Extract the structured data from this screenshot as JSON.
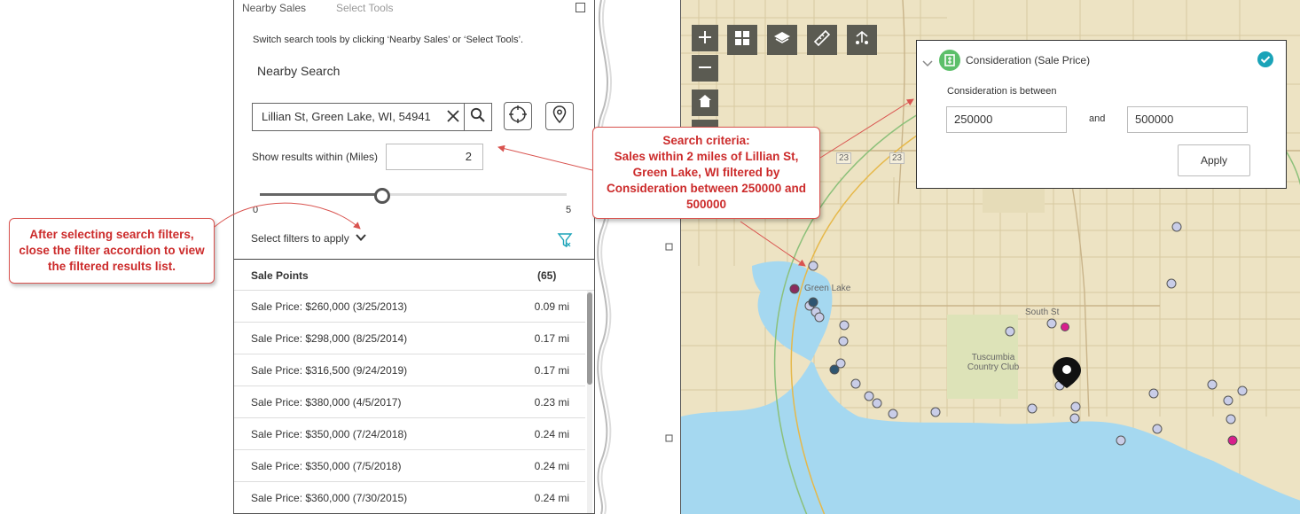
{
  "panel": {
    "tabs": [
      "Nearby Sales",
      "Select Tools"
    ],
    "instruction": "Switch search tools by clicking ‘Nearby Sales’ or ‘Select Tools’.",
    "section_title": "Nearby Search",
    "search_value": "Lillian St, Green Lake, WI, 54941",
    "distance_label": "Show results within (Miles)",
    "distance_value": "2",
    "slider": {
      "min": "0",
      "max": "5",
      "value_fraction": 0.4
    },
    "filters_label": "Select filters to apply",
    "results_title": "Sale Points",
    "results_count": "(65)",
    "results": [
      {
        "price": "Sale Price: $260,000 (3/25/2013)",
        "dist": "0.09 mi"
      },
      {
        "price": "Sale Price: $298,000 (8/25/2014)",
        "dist": "0.17 mi"
      },
      {
        "price": "Sale Price: $316,500 (9/24/2019)",
        "dist": "0.17 mi"
      },
      {
        "price": "Sale Price: $380,000 (4/5/2017)",
        "dist": "0.23 mi"
      },
      {
        "price": "Sale Price: $350,000 (7/24/2018)",
        "dist": "0.24 mi"
      },
      {
        "price": "Sale Price: $350,000 (7/5/2018)",
        "dist": "0.24 mi"
      },
      {
        "price": "Sale Price: $360,000 (7/30/2015)",
        "dist": "0.24 mi"
      }
    ]
  },
  "callouts": {
    "left": "After selecting search filters, close the filter accordion to view the filtered results list.",
    "mid": "Search criteria:\nSales within 2 miles of Lillian St, Green Lake, WI filtered by Consideration between 250000 and 500000"
  },
  "filter_popup": {
    "title": "Consideration (Sale Price)",
    "subtitle": "Consideration is between",
    "min_value": "250000",
    "and_label": "and",
    "max_value": "500000",
    "apply_label": "Apply"
  },
  "map": {
    "labels": {
      "town": "Green Lake",
      "club": "Tuscumbia Country Club",
      "road1": "23",
      "road2": "23",
      "south_st": "South St"
    },
    "colors": {
      "land": "#ede3c3",
      "water": "#a5d8f0",
      "controls": "#5b5b52",
      "accent": "#1aa3b8",
      "callout": "#d9534f"
    }
  }
}
